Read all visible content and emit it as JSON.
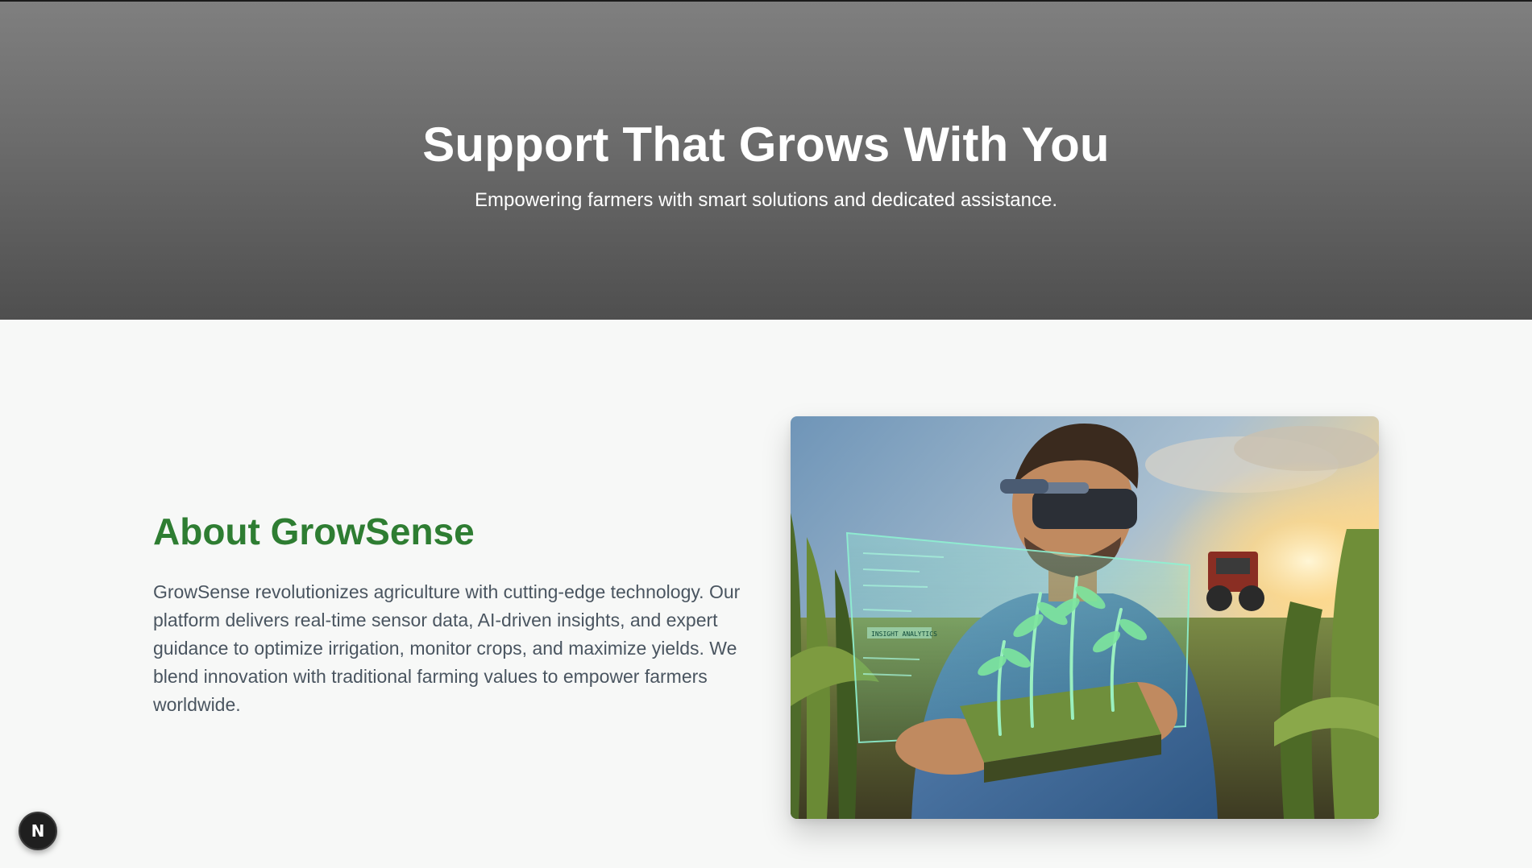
{
  "hero": {
    "title": "Support That Grows With You",
    "subtitle": "Empowering farmers with smart solutions and dedicated assistance."
  },
  "about": {
    "heading": "About GrowSense",
    "body": "GrowSense revolutionizes agriculture with cutting-edge technology. Our platform delivers real-time sensor data, AI-driven insights, and expert guidance to optimize irrigation, monitor crops, and maximize yields. We blend innovation with traditional farming values to empower farmers worldwide.",
    "image": {
      "overlay_text": "INSIGHT ANALYTICS"
    }
  },
  "dev_badge": {
    "label": "N",
    "icon": "nextjs-icon"
  },
  "colors": {
    "accent_green": "#2e7d32",
    "hero_gray": "#6b6b6b"
  }
}
